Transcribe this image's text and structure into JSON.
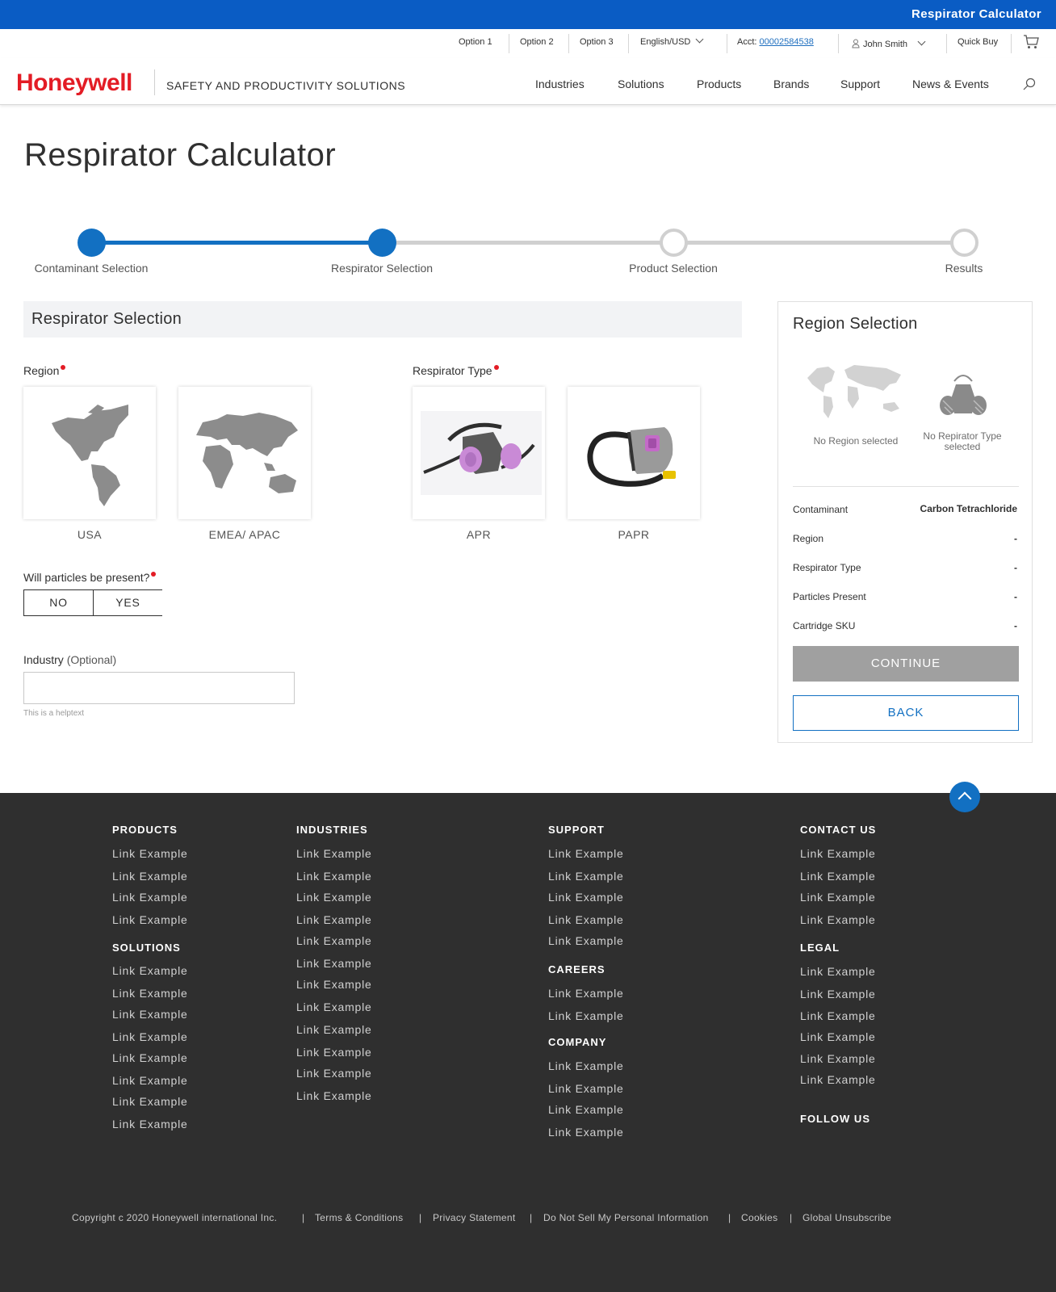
{
  "topbar": {
    "title": "Respirator Calculator"
  },
  "utility": {
    "option1": "Option 1",
    "option2": "Option 2",
    "option3": "Option 3",
    "language": "English/USD",
    "acct_label": "Acct:",
    "acct_number": "00002584538",
    "user_name": "John Smith",
    "quick_buy": "Quick Buy"
  },
  "header": {
    "logo": "Honeywell",
    "tagline": "SAFETY AND PRODUCTIVITY SOLUTIONS",
    "nav": [
      "Industries",
      "Solutions",
      "Products",
      "Brands",
      "Support",
      "News & Events"
    ]
  },
  "page_title": "Respirator Calculator",
  "stepper": {
    "steps": [
      {
        "label": "Contaminant Selection",
        "state": "done"
      },
      {
        "label": "Respirator Selection",
        "state": "done"
      },
      {
        "label": "Product Selection",
        "state": "todo"
      },
      {
        "label": "Results",
        "state": "todo"
      }
    ]
  },
  "form": {
    "section_title": "Respirator Selection",
    "region_label": "Region",
    "region_options": [
      "USA",
      "EMEA/ APAC"
    ],
    "respirator_label": "Respirator Type",
    "respirator_options": [
      "APR",
      "PAPR"
    ],
    "particles_label": "Will particles be present?",
    "particles_options": [
      "NO",
      "YES"
    ],
    "industry_label": "Industry",
    "industry_optional": "(Optional)",
    "industry_value": "",
    "helptext": "This is a helptext"
  },
  "panel": {
    "title": "Region Selection",
    "no_region": "No Region selected",
    "no_respirator": "No Repirator Type selected",
    "summary": [
      {
        "label": "Contaminant",
        "value": "Carbon Tetrachloride"
      },
      {
        "label": "Region",
        "value": "-"
      },
      {
        "label": "Respirator Type",
        "value": "-"
      },
      {
        "label": "Particles Present",
        "value": "-"
      },
      {
        "label": "Cartridge SKU",
        "value": "-"
      }
    ],
    "continue": "CONTINUE",
    "back": "BACK"
  },
  "footer": {
    "products": "PRODUCTS",
    "solutions": "SOLUTIONS",
    "industries": "INDUSTRIES",
    "support": "SUPPORT",
    "careers": "CAREERS",
    "company": "COMPANY",
    "contact": "CONTACT US",
    "legal": "LEGAL",
    "follow": "FOLLOW US",
    "link": "Link Example",
    "copyright": "Copyright c  2020 Honeywell international Inc.",
    "legal_links": [
      "Terms & Conditions",
      "Privacy Statement",
      "Do Not Sell My Personal Information",
      "Cookies",
      "Global Unsubscribe"
    ]
  },
  "colors": {
    "brand_blue": "#1270c2",
    "topbar_blue": "#0a5cc4",
    "honeywell_red": "#e31c25",
    "footer_bg": "#2f2f2f"
  }
}
